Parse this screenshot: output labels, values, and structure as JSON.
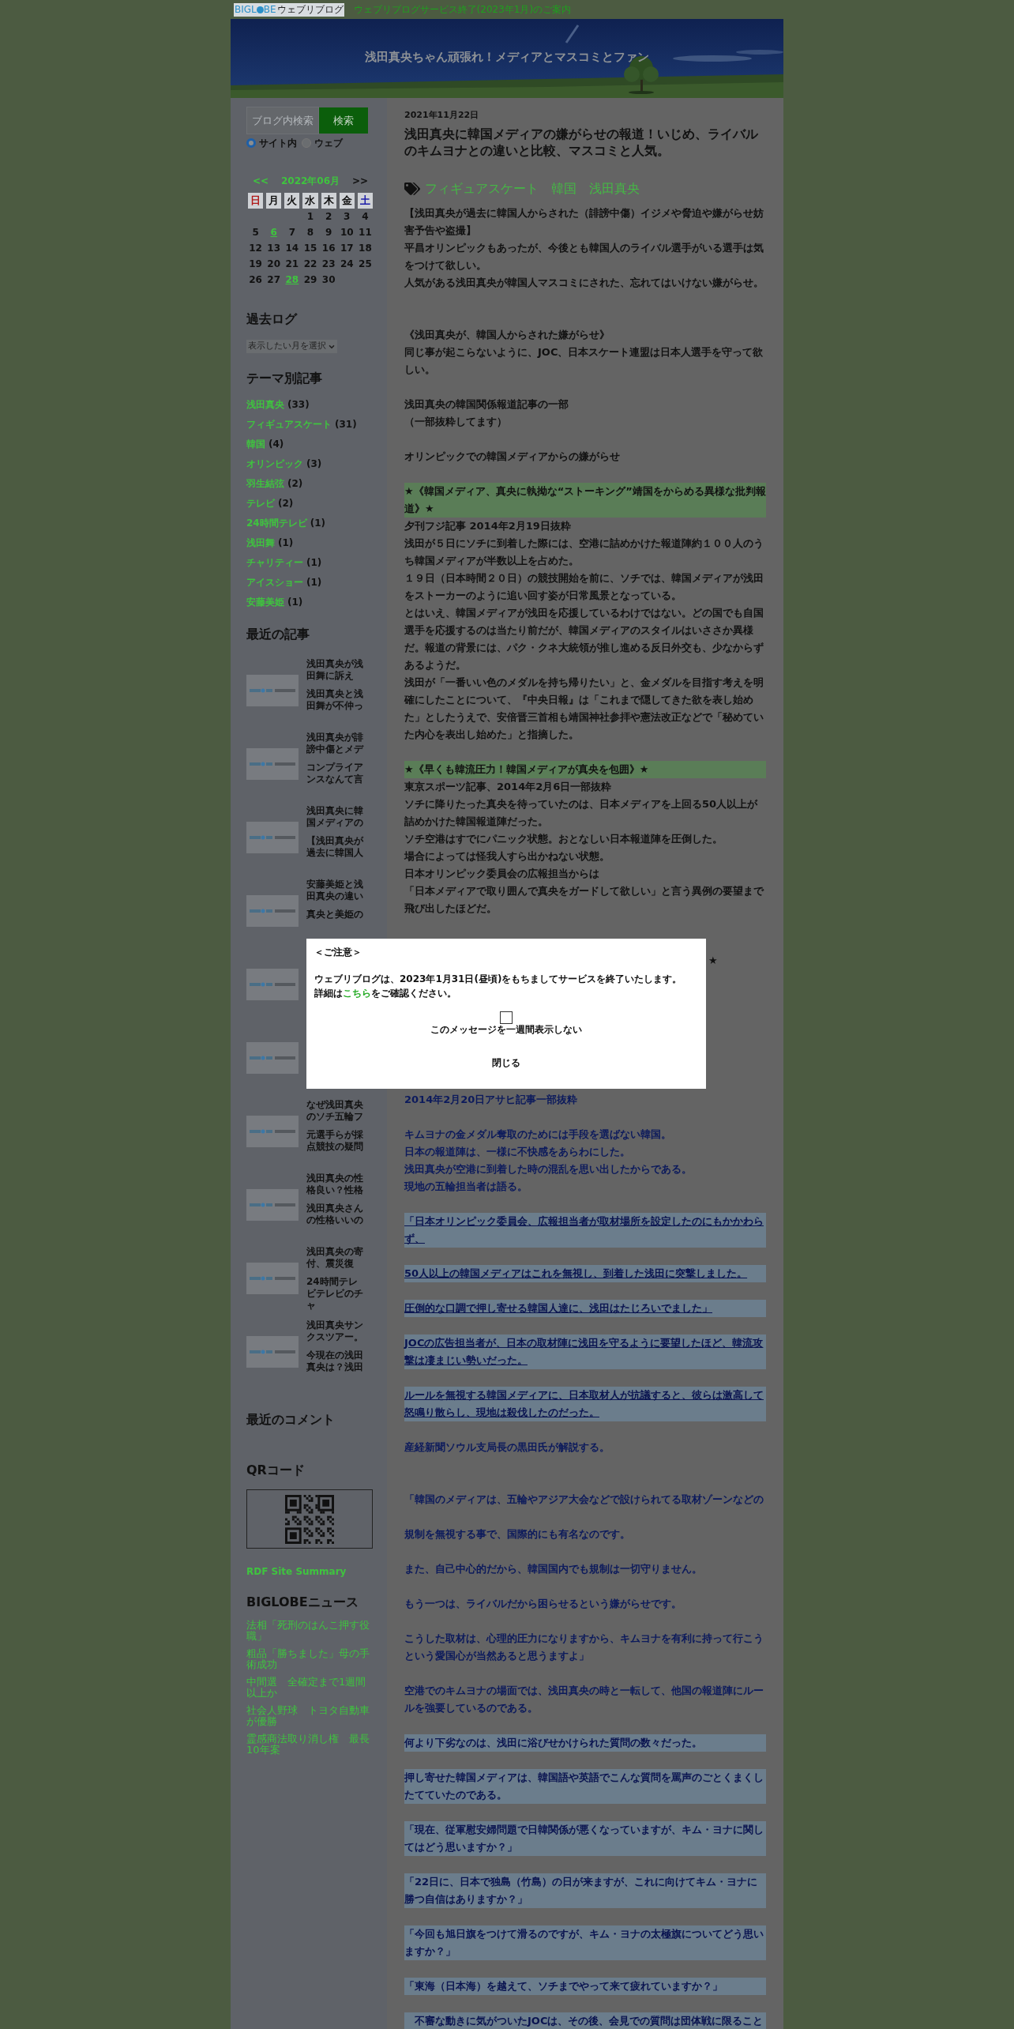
{
  "top_bar": {
    "logo": {
      "part_1": "BIGL",
      "part_2": "BE",
      "part_3": "ウェブリブログ"
    },
    "notice_link": "ウェブリブログサービス終了(2023年1月)のご案内"
  },
  "header": {
    "title": "浅田真央ちゃん頑張れ！メディアとマスコミとファン"
  },
  "sidebar": {
    "search": {
      "placeholder": "ブログ内検索",
      "button": "検索",
      "scopes": [
        {
          "label": "サイト内",
          "selected": true
        },
        {
          "label": "ウェブ",
          "selected": false
        }
      ]
    },
    "calendar": {
      "prev": "<<",
      "month": "2022年06月",
      "next": ">>",
      "weekdays": [
        {
          "label": "日",
          "color": "#b01818",
          "month_starts": false
        },
        {
          "label": "月",
          "color": "#111111",
          "month_starts": false
        },
        {
          "label": "火",
          "color": "#111111",
          "month_starts": false
        },
        {
          "label": "水",
          "color": "#111111",
          "month_starts": true
        },
        {
          "label": "木",
          "color": "#111111",
          "month_starts": false
        },
        {
          "label": "金",
          "color": "#111111",
          "month_starts": false
        },
        {
          "label": "土",
          "color": "#1a1aa8",
          "month_starts": false
        }
      ],
      "days": [
        {
          "day": "1",
          "linked": false
        },
        {
          "day": "2",
          "linked": false
        },
        {
          "day": "3",
          "linked": false
        },
        {
          "day": "4",
          "linked": false
        },
        {
          "day": "5",
          "linked": false
        },
        {
          "day": "6",
          "linked": true
        },
        {
          "day": "7",
          "linked": false
        },
        {
          "day": "8",
          "linked": false
        },
        {
          "day": "9",
          "linked": false
        },
        {
          "day": "10",
          "linked": false
        },
        {
          "day": "11",
          "linked": false
        },
        {
          "day": "12",
          "linked": false
        },
        {
          "day": "13",
          "linked": false
        },
        {
          "day": "14",
          "linked": false
        },
        {
          "day": "15",
          "linked": false
        },
        {
          "day": "16",
          "linked": false
        },
        {
          "day": "17",
          "linked": false
        },
        {
          "day": "18",
          "linked": false
        },
        {
          "day": "19",
          "linked": false
        },
        {
          "day": "20",
          "linked": false
        },
        {
          "day": "21",
          "linked": false
        },
        {
          "day": "22",
          "linked": false
        },
        {
          "day": "23",
          "linked": false
        },
        {
          "day": "24",
          "linked": false
        },
        {
          "day": "25",
          "linked": false
        },
        {
          "day": "26",
          "linked": false
        },
        {
          "day": "27",
          "linked": false
        },
        {
          "day": "28",
          "linked": true
        },
        {
          "day": "29",
          "linked": false
        },
        {
          "day": "30",
          "linked": false
        }
      ]
    },
    "archive": {
      "heading": "過去ログ",
      "select": "表示したい月を選択"
    },
    "themes": {
      "heading": "テーマ別記事",
      "items": [
        {
          "name": "浅田真央",
          "count": "(33)"
        },
        {
          "name": "フィギュアスケート",
          "count": "(31)"
        },
        {
          "name": "韓国",
          "count": "(4)"
        },
        {
          "name": "オリンピック",
          "count": "(3)"
        },
        {
          "name": "羽生結弦",
          "count": "(2)"
        },
        {
          "name": "テレビ",
          "count": "(2)"
        },
        {
          "name": "24時間テレビ",
          "count": "(1)"
        },
        {
          "name": "浅田舞",
          "count": "(1)"
        },
        {
          "name": "チャリティー",
          "count": "(1)"
        },
        {
          "name": "アイスショー",
          "count": "(1)"
        },
        {
          "name": "安藤美姫",
          "count": "(1)"
        }
      ]
    },
    "recent": {
      "heading": "最近の記事",
      "items": [
        {
          "kind": "article",
          "title": "浅田真央が浅田舞に訴え",
          "excerpt": "浅田真央と浅田舞が不仲っ"
        },
        {
          "kind": "article",
          "title": "浅田真央が誹謗中傷とメデ",
          "excerpt": "コンプライアンスなんて言"
        },
        {
          "kind": "article",
          "title": "浅田真央に韓国メディアの",
          "excerpt": "【浅田真央が過去に韓国人"
        },
        {
          "kind": "article",
          "title": "安藤美姫と浅田真央の違い",
          "excerpt": "真央と美姫の"
        },
        {
          "kind": "picture"
        },
        {
          "kind": "picture"
        },
        {
          "kind": "article",
          "title": "なぜ浅田真央のソチ五輪フ",
          "excerpt": "元選手らが採点競技の疑問"
        },
        {
          "kind": "article",
          "title": "浅田真央の性格良い？性格",
          "excerpt": "浅田真央さんの性格いいの"
        },
        {
          "kind": "article",
          "title": "浅田真央の寄付、震災復",
          "excerpt": "24時間テレビテレビのチャ"
        },
        {
          "kind": "article",
          "title": "浅田真央サンクスツアー。",
          "excerpt": "今現在の浅田真央は？浅田"
        }
      ]
    },
    "comments": {
      "heading": "最近のコメント"
    },
    "qr": {
      "heading": "QRコード"
    },
    "rdf_link": "RDF Site Summary",
    "news": {
      "heading": "BIGLOBEニュース",
      "items": [
        "法相「死刑のはんこ押す役職」",
        "粗品「勝ちました」母の手術成功",
        "中間選　全確定まで1週間以上か",
        "社会人野球　トヨタ自動車が優勝",
        "霊感商法取り消し権　最長10年案"
      ]
    }
  },
  "article": {
    "date": "2021年11月22日",
    "title": "浅田真央に韓国メディアの嫌がらせの報道！いじめ、ライバルのキムヨナとの違いと比較、マスコミと人気。",
    "tags": [
      "フィギュアスケート",
      "韓国",
      "浅田真央"
    ],
    "body": [
      {
        "kind": "text",
        "text": "【浅田真央が過去に韓国人からされた（誹謗中傷）イジメや脅迫や嫌がらせ妨害予告や盗撮】"
      },
      {
        "kind": "text",
        "text": "平昌オリンピックもあったが、今後とも韓国人のライバル選手がいる選手は気をつけて欲しい。"
      },
      {
        "kind": "text",
        "text": "人気がある浅田真央が韓国人マスコミにされた、忘れてはいけない嫌がらせ。"
      },
      {
        "kind": "blank"
      },
      {
        "kind": "blank"
      },
      {
        "kind": "text",
        "text": "《浅田真央が、韓国人からされた嫌がらせ》"
      },
      {
        "kind": "text",
        "text": "同じ事が起こらないように、JOC、日本スケート連盟は日本人選手を守って欲しい。"
      },
      {
        "kind": "blank"
      },
      {
        "kind": "text",
        "text": "浅田真央の韓国関係報道記事の一部"
      },
      {
        "kind": "text",
        "text": "（一部抜粋してます）"
      },
      {
        "kind": "blank"
      },
      {
        "kind": "text",
        "text": "オリンピックでの韓国メディアからの嫌がらせ"
      },
      {
        "kind": "blank"
      },
      {
        "kind": "marker",
        "text": "★《韓国メディア、真央に執拗な“ストーキング”靖国をからめる異様な批判報道》★"
      },
      {
        "kind": "text",
        "text": "夕刊フジ記事 2014年2月19日抜粋"
      },
      {
        "kind": "text",
        "text": "浅田が５日にソチに到着した際には、空港に詰めかけた報道陣約１００人のうち韓国メディアが半数以上を占めた。"
      },
      {
        "kind": "text",
        "text": "１９日（日本時間２０日）の競技開始を前に、ソチでは、韓国メディアが浅田をストーカーのように追い回す姿が日常風景となっている。"
      },
      {
        "kind": "text",
        "text": "とはいえ、韓国メディアが浅田を応援しているわけではない。どの国でも自国選手を応援するのは当たり前だが、韓国メディアのスタイルはいささか異様だ。報道の背景には、パク・クネ大統領が推し進める反日外交も、少なからずあるようだ。"
      },
      {
        "kind": "text",
        "text": "浅田が「一番いい色のメダルを持ち帰りたい」と、金メダルを目指す考えを明確にしたことについて、『中央日報』は「これまで隠してきた欲を表し始めた」としたうえで、安倍晋三首相も靖国神社参拝や憲法改正などで「秘めていた内心を表出し始めた」と指摘した。"
      },
      {
        "kind": "blank"
      },
      {
        "kind": "marker",
        "text": "★《早くも韓流圧力！韓国メディアが真央を包囲》★"
      },
      {
        "kind": "text",
        "text": "東京スポーツ記事、2014年2月6日一部抜粋"
      },
      {
        "kind": "text",
        "text": "ソチに降りたった真央を待っていたのは、日本メディアを上回る50人以上が詰めかけた韓国報道陣だった。"
      },
      {
        "kind": "text",
        "text": "ソチ空港はすでにパニック状態。おとなしい日本報道陣を圧倒した。"
      },
      {
        "kind": "text",
        "text": "場合によっては怪我人すら出かねない状態。"
      },
      {
        "kind": "text",
        "text": "日本オリンピック委員会の広報担当からは"
      },
      {
        "kind": "text",
        "text": "「日本メディアで取り囲んで真央をガードして欲しい」と言う異例の要望まで飛び出したほどだ。"
      },
      {
        "kind": "blank"
      },
      {
        "kind": "blank"
      },
      {
        "kind": "tail",
        "text": "★"
      },
      {
        "kind": "blank"
      },
      {
        "kind": "blank"
      },
      {
        "kind": "blank"
      },
      {
        "kind": "blank"
      },
      {
        "kind": "blank"
      },
      {
        "kind": "blank"
      },
      {
        "kind": "blank"
      },
      {
        "kind": "blue",
        "text": "2014年2月20日アサヒ記事一部抜粋"
      },
      {
        "kind": "blank"
      },
      {
        "kind": "blue",
        "text": "キムヨナの金メダル奪取のためには手段を選ばない韓国。"
      },
      {
        "kind": "blue",
        "text": "日本の報道陣は、一様に不快感をあらわにした。"
      },
      {
        "kind": "blue",
        "text": "浅田真央が空港に到着した時の混乱を思い出したからである。"
      },
      {
        "kind": "blue",
        "text": "現地の五輪担当者は語る。"
      },
      {
        "kind": "blank"
      },
      {
        "kind": "underlined",
        "text": "「日本オリンピック委員会、広報担当者が取材場所を設定したのにもかかわらず、"
      },
      {
        "kind": "blank"
      },
      {
        "kind": "underlined",
        "text": "50人以上の韓国メディアはこれを無視し、到着した浅田に突撃しました。"
      },
      {
        "kind": "blank"
      },
      {
        "kind": "underlined",
        "text": "圧倒的な口調で押し寄せる韓国人達に、浅田はたじろいでました」"
      },
      {
        "kind": "blank"
      },
      {
        "kind": "underlined",
        "text": "JOCの広告担当者が、日本の取材陣に浅田を守るように要望したほど、韓流攻撃は凄まじい勢いだった。"
      },
      {
        "kind": "blank"
      },
      {
        "kind": "underlined",
        "text": "ルールを無視する韓国メディアに、日本取材人が抗議すると、彼らは激高して怒鳴り散らし、現地は殺伐したのだった。"
      },
      {
        "kind": "blank"
      },
      {
        "kind": "blue",
        "text": "産経新聞ソウル支局長の黒田氏が解説する。"
      },
      {
        "kind": "blank"
      },
      {
        "kind": "blank"
      },
      {
        "kind": "blue",
        "text": "「韓国のメディアは、五輪やアジア大会などで設けられてる取材ゾーンなどの"
      },
      {
        "kind": "blank"
      },
      {
        "kind": "blue",
        "text": "規制を無視する事で、国際的にも有名なのです。"
      },
      {
        "kind": "blank"
      },
      {
        "kind": "blue",
        "text": "また、自己中心的だから、韓国国内でも規制は一切守りません。"
      },
      {
        "kind": "blank"
      },
      {
        "kind": "blue",
        "text": "もう一つは、ライバルだから困らせるという嫌がらせです。"
      },
      {
        "kind": "blank"
      },
      {
        "kind": "blue",
        "text": "こうした取材は、心理的圧力になりますから、キムヨナを有利に持って行こうという愛国心が当然あると思うますよ」"
      },
      {
        "kind": "blank"
      },
      {
        "kind": "blue",
        "text": "空港でのキムヨナの場面では、浅田真央の時と一転して、他国の報道陣にルールを強要しているのである。"
      },
      {
        "kind": "blank"
      },
      {
        "kind": "quote",
        "text": "何より下劣なのは、浅田に浴びせかけられた質問の数々だった。"
      },
      {
        "kind": "blank"
      },
      {
        "kind": "quote",
        "text": "押し寄せた韓国メディアは、韓国語や英語でこんな質問を罵声のごとくまくしたてていたのである。"
      },
      {
        "kind": "blank"
      },
      {
        "kind": "quote",
        "text": "「現在、従軍慰安婦問題で日韓関係が悪くなっていますが、キム・ヨナに関してはどう思いますか？」"
      },
      {
        "kind": "blank"
      },
      {
        "kind": "quote",
        "text": "「22日に、日本で独島（竹島）の日が来ますが、これに向けてキム・ヨナに勝つ自信はありますか？」"
      },
      {
        "kind": "blank"
      },
      {
        "kind": "quote",
        "text": "「今回も旭日旗をつけて滑るのですが、キム・ヨナの太極旗についてどう思いますか？」"
      },
      {
        "kind": "blank"
      },
      {
        "kind": "quote",
        "text": "「東海（日本海）を越えて、ソチまでやって来て疲れていますか？」"
      },
      {
        "kind": "blank"
      },
      {
        "kind": "quote",
        "text": "　不審な動きに気がついたJOCは、その後、会見での質問は団体戦に限ること"
      }
    ]
  },
  "modal": {
    "heading": "＜ご注意＞",
    "message": "ウェブリブログは、2023年1月31日(昼頃)をもちましてサービスを終了いたします。",
    "detail_before": "詳細は",
    "detail_link": "こちら",
    "detail_after": "をご確認ください。",
    "checkbox": {
      "label": "このメッセージを一週間表示しない",
      "checked": false
    },
    "close": "閉じる"
  }
}
